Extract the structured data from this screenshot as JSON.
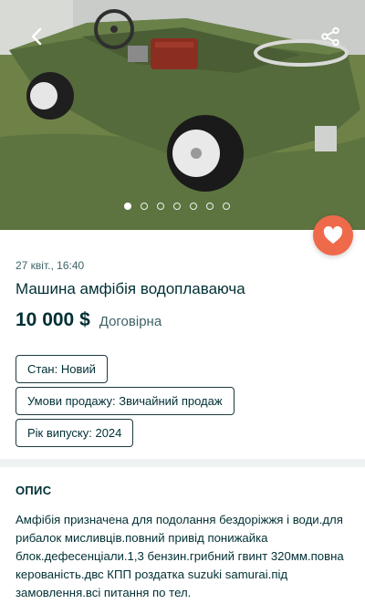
{
  "gallery": {
    "image_alt": "Green amphibious car with steering wheel and red seat on grass",
    "dots_count": 7,
    "active_dot": 0
  },
  "listing": {
    "date": "27 квіт., 16:40",
    "title": "Машина амфібія водоплаваюча",
    "price": "10 000 $",
    "price_note": "Договірна",
    "tags": [
      "Стан: Новий",
      "Умови продажу: Звичайний продаж",
      "Рік випуску: 2024"
    ]
  },
  "description": {
    "heading": "ОПИС",
    "text": "Амфібія призначена для подолання бездоріжжя і води.для рибалок мисливців.повний привід понижайка блок.дефеcенціали.1,3 бензин.грибний гвинт 320мм.повна керованість.двс КПП роздатка suzuki samurai.під замовлення.всі питання по тел."
  },
  "colors": {
    "favorite_button": "#ef6a4b",
    "primary_text": "#002f34",
    "secondary_text": "#406367"
  },
  "icons": {
    "back": "chevron-left-icon",
    "share": "share-icon",
    "favorite": "heart-icon"
  }
}
